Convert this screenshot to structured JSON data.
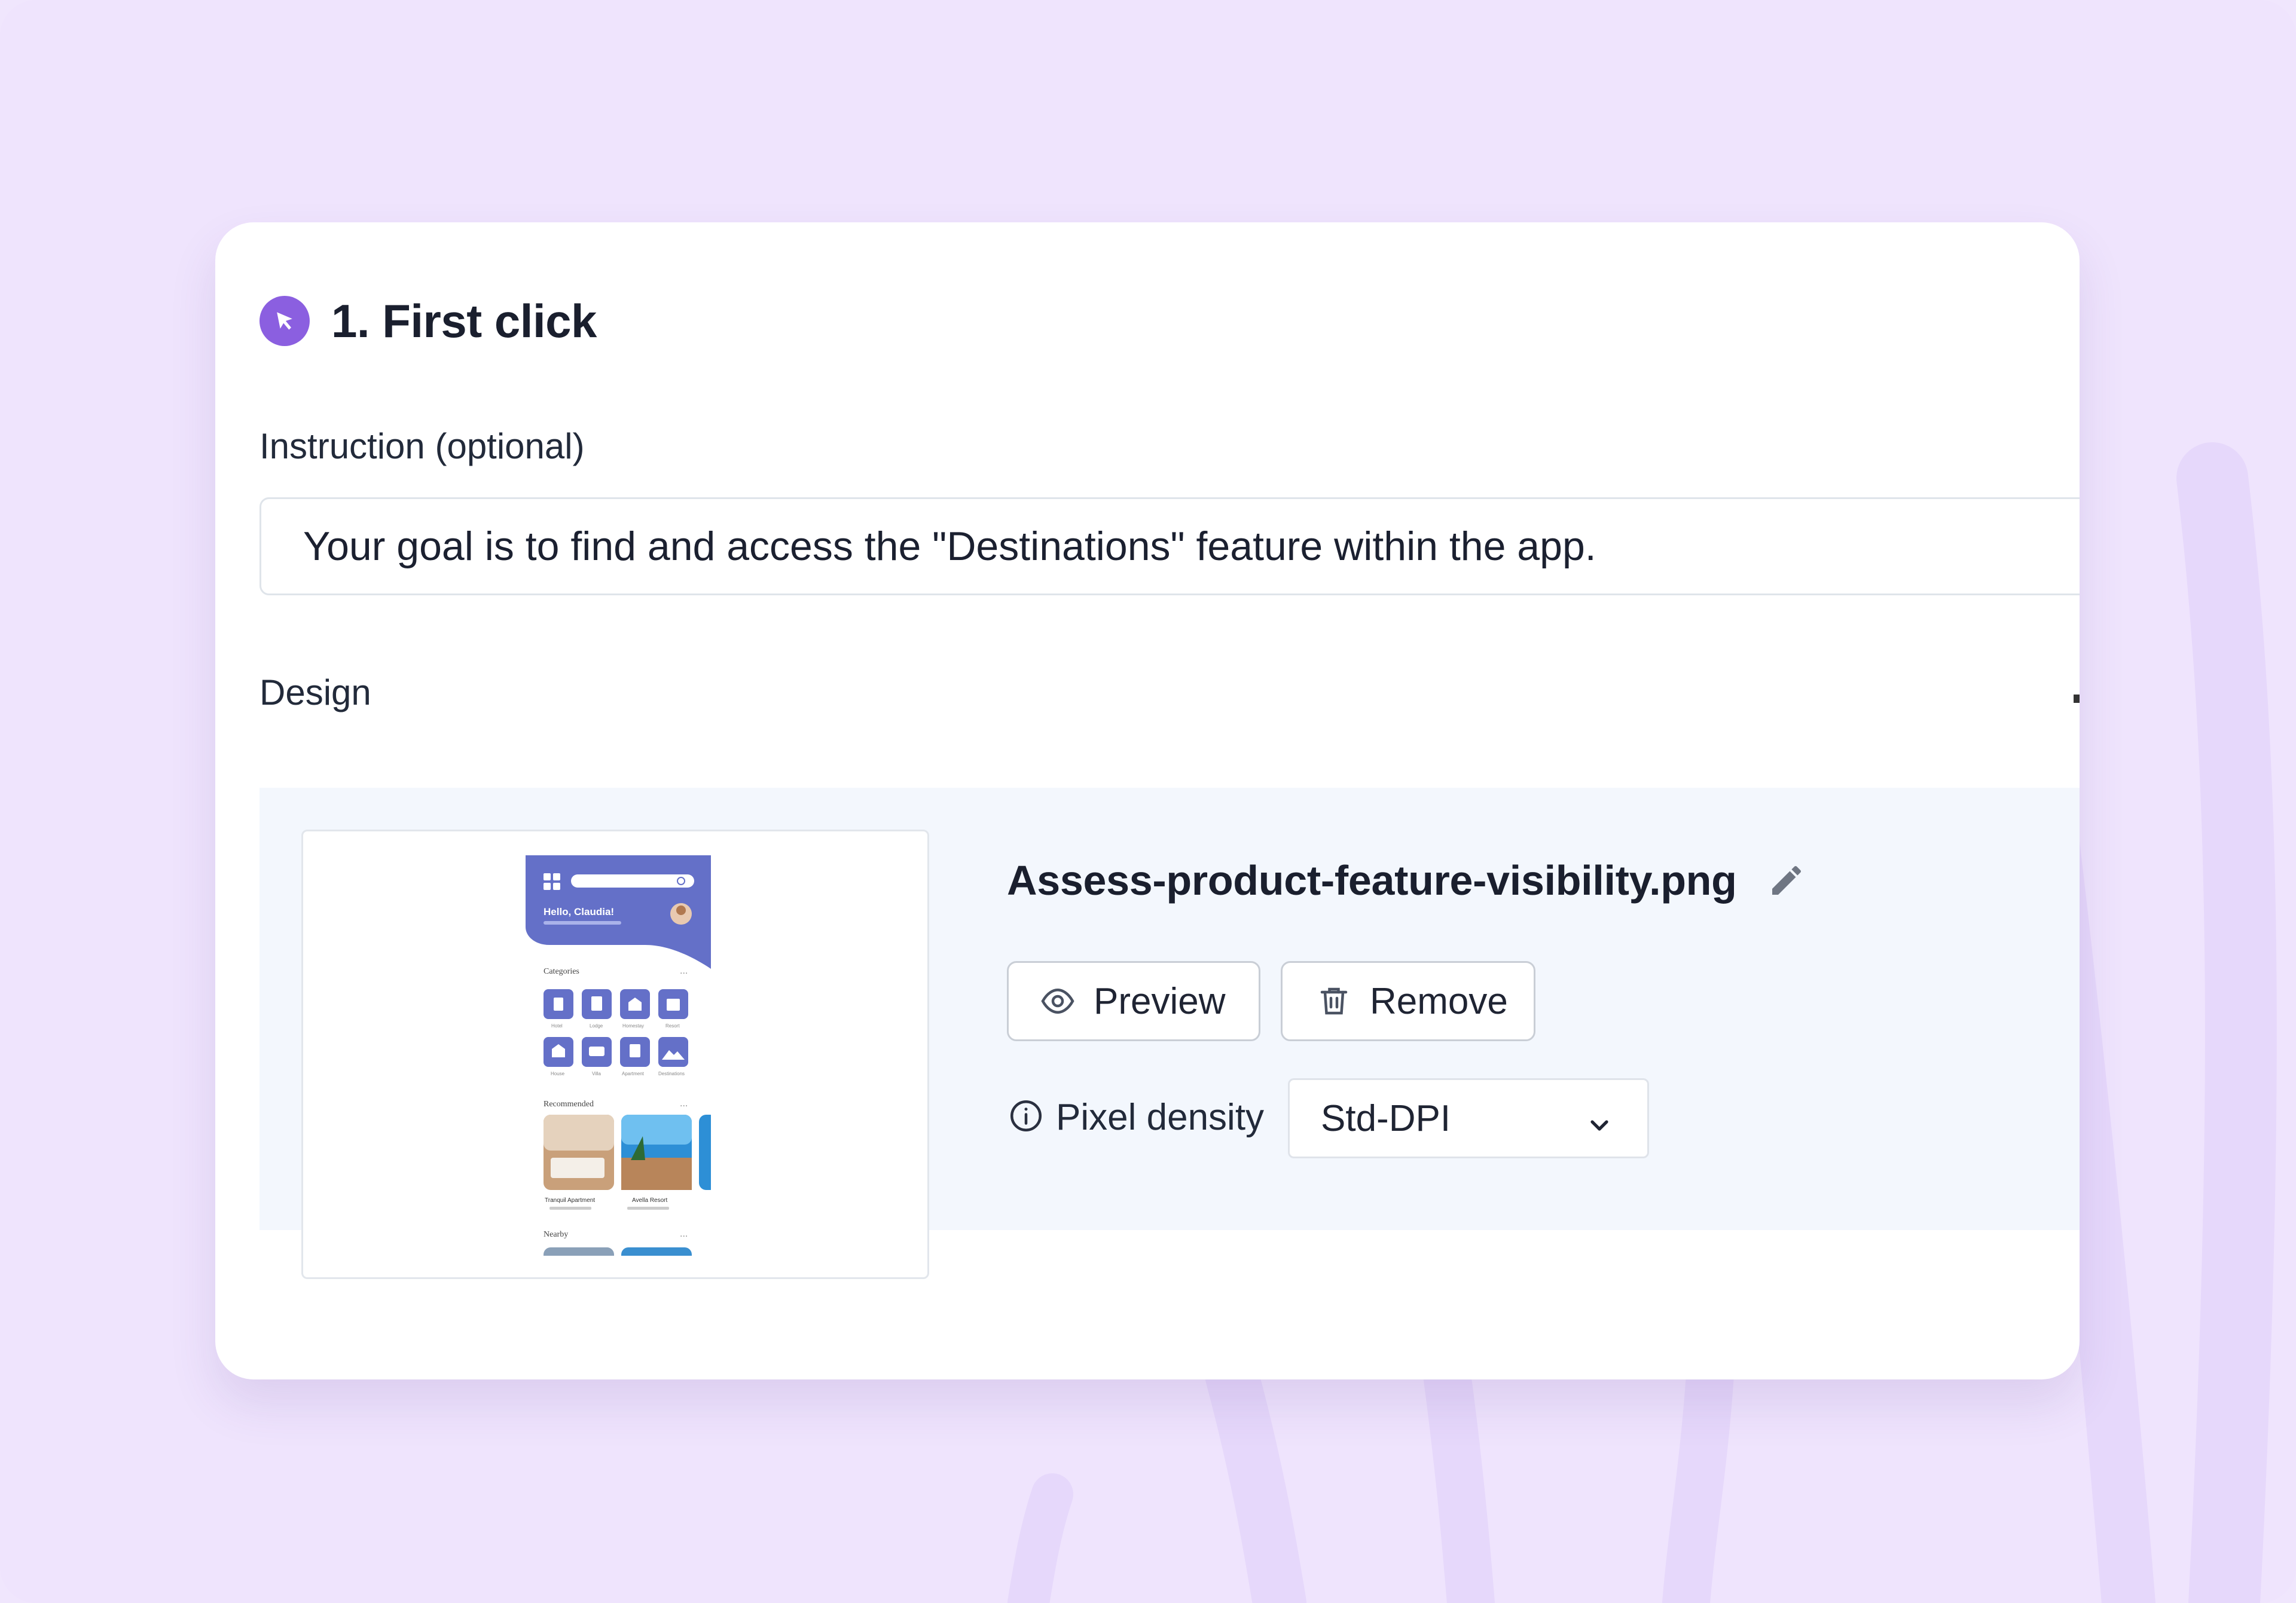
{
  "step": {
    "title": "1. First click",
    "icon": "cursor-click-icon",
    "accent_color": "#8b5fe0"
  },
  "instruction": {
    "label": "Instruction (optional)",
    "value": "Your goal is to find and access the \"Destinations\" feature within the app."
  },
  "design": {
    "label": "Design",
    "filename": "Assess-product-feature-visibility.png",
    "edit_icon": "pencil-icon",
    "preview_label": "Preview",
    "remove_label": "Remove",
    "pixel_density_label": "Pixel density",
    "pixel_density_value": "Std-DPI",
    "thumbnail": {
      "greeting": "Hello, Claudia!",
      "categories_title": "Categories",
      "categories": [
        "Hotel",
        "Lodge",
        "Homestay",
        "Resort",
        "House",
        "Villa",
        "Apartment",
        "Destinations"
      ],
      "recommended_title": "Recommended",
      "recommended": [
        "Tranquil Apartment",
        "Avella Resort"
      ],
      "nearby_title": "Nearby",
      "brand_color": "#6470c8"
    }
  }
}
